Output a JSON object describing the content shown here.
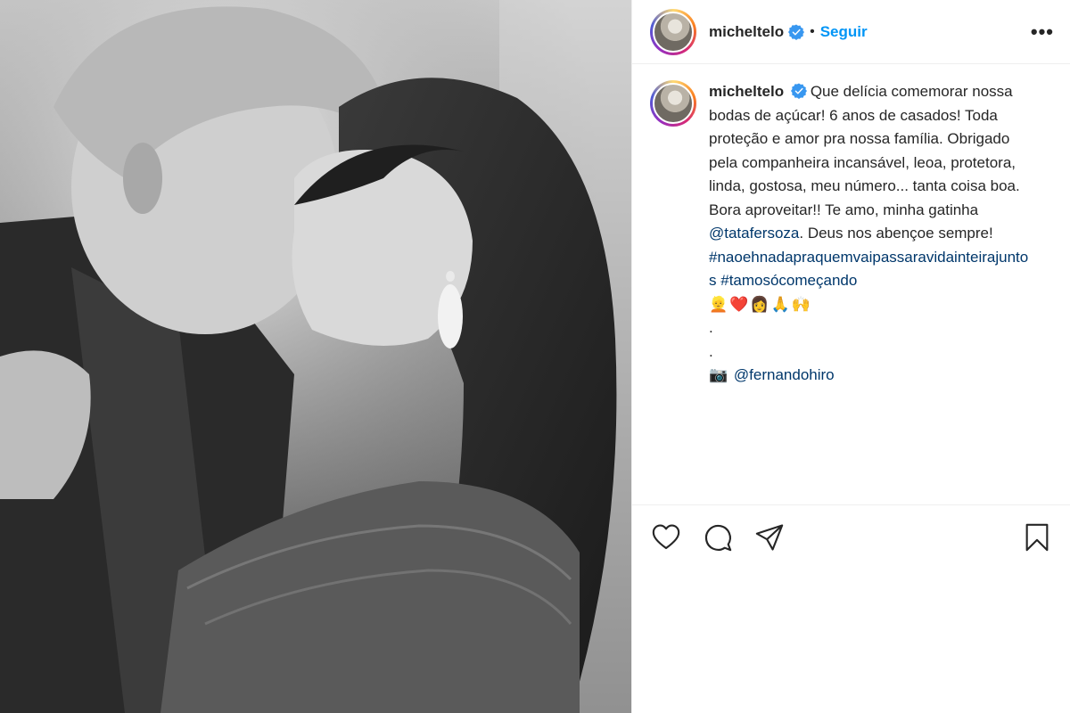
{
  "post": {
    "photo": {
      "description_icon": "photo",
      "tone": "black-and-white"
    },
    "header": {
      "avatar_icon": "avatar",
      "username": "micheltelo",
      "verified_icon": "verified-badge-icon",
      "separator": "•",
      "follow_label": "Seguir",
      "more_label": "•••"
    },
    "caption": {
      "username": "micheltelo",
      "text_1": "Que delícia comemorar nossa bodas de açúcar! 6 anos de casados! Toda proteção e amor pra nossa família. Obrigado pela companheira incansável, leoa, protetora, linda, gostosa, meu número... tanta coisa boa. Bora aproveitar!! Te amo, minha gatinha",
      "mention_1": "@tatafersoza",
      "text_2": ". Deus nos abençoe sempre!",
      "hashtag_1": "#naoehnadapraquemvaipassaravidainteirajuntos",
      "hashtag_2": "#tamosócomeçando",
      "emojis": "👱❤️👩🙏🙌",
      "dot_1": ".",
      "dot_2": ".",
      "camera_emoji": "📷",
      "mention_2": "@fernandohiro"
    },
    "actions": {
      "like_icon": "heart-icon",
      "comment_icon": "comment-icon",
      "share_icon": "share-icon",
      "save_icon": "bookmark-icon"
    },
    "colors": {
      "link": "#00376b",
      "follow": "#0095f6",
      "verified": "#3897f0",
      "text": "#262626"
    }
  }
}
